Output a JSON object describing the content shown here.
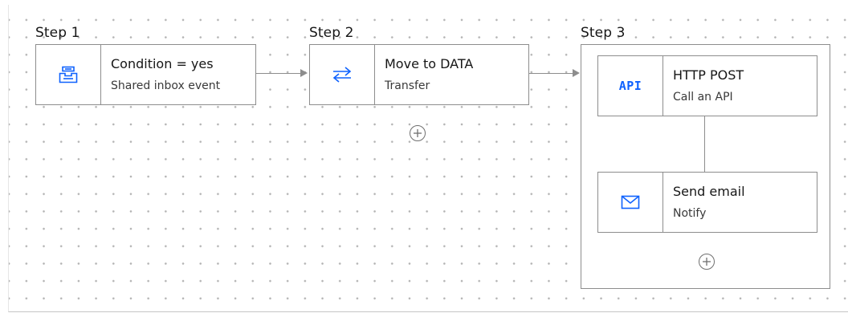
{
  "steps": [
    {
      "label": "Step 1"
    },
    {
      "label": "Step 2"
    },
    {
      "label": "Step 3"
    }
  ],
  "nodes": {
    "condition": {
      "title": "Condition = yes",
      "subtitle": "Shared inbox event",
      "icon": "inbox-tray-icon"
    },
    "move": {
      "title": "Move to DATA",
      "subtitle": "Transfer",
      "icon": "swap-arrows-icon"
    },
    "http": {
      "title": "HTTP POST",
      "subtitle": "Call an API",
      "icon_text": "API",
      "icon": "api-icon"
    },
    "email": {
      "title": "Send email",
      "subtitle": "Notify",
      "icon": "envelope-icon"
    }
  },
  "colors": {
    "accent": "#0f62fe",
    "border": "#8d8d8d",
    "dot": "#b3b3b3"
  }
}
